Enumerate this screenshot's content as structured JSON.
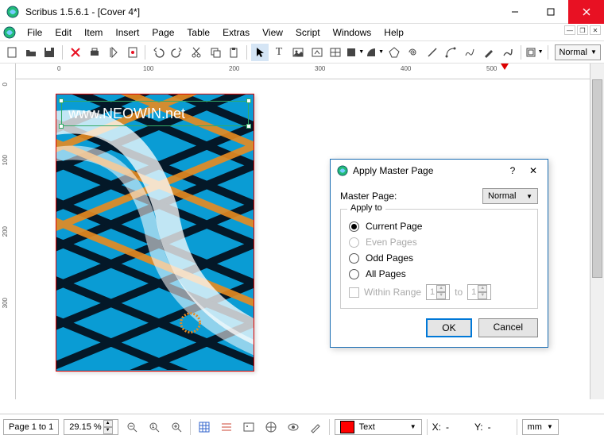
{
  "window": {
    "title": "Scribus 1.5.6.1 - [Cover 4*]"
  },
  "menu": {
    "items": [
      "File",
      "Edit",
      "Item",
      "Insert",
      "Page",
      "Table",
      "Extras",
      "View",
      "Script",
      "Windows",
      "Help"
    ]
  },
  "toolbar": {
    "mode": "Normal"
  },
  "ruler": {
    "h_labels": [
      "0",
      "100",
      "200",
      "300",
      "400",
      "500"
    ],
    "v_labels": [
      "0",
      "100",
      "200",
      "300"
    ]
  },
  "page": {
    "text": "www.NEOWIN.net"
  },
  "status": {
    "pages": "Page 1 to 1",
    "zoom": "29.15 %",
    "layer_label": "Text",
    "x_label": "X:",
    "x_val": "-",
    "y_label": "Y:",
    "y_val": "-",
    "unit": "mm"
  },
  "dialog": {
    "title": "Apply Master Page",
    "master_label": "Master Page:",
    "master_value": "Normal",
    "group_label": "Apply to",
    "opt_current": "Current Page",
    "opt_even": "Even Pages",
    "opt_odd": "Odd Pages",
    "opt_all": "All Pages",
    "range_label": "Within Range",
    "range_from": "1",
    "range_to_label": "to",
    "range_to": "1",
    "ok": "OK",
    "cancel": "Cancel"
  }
}
